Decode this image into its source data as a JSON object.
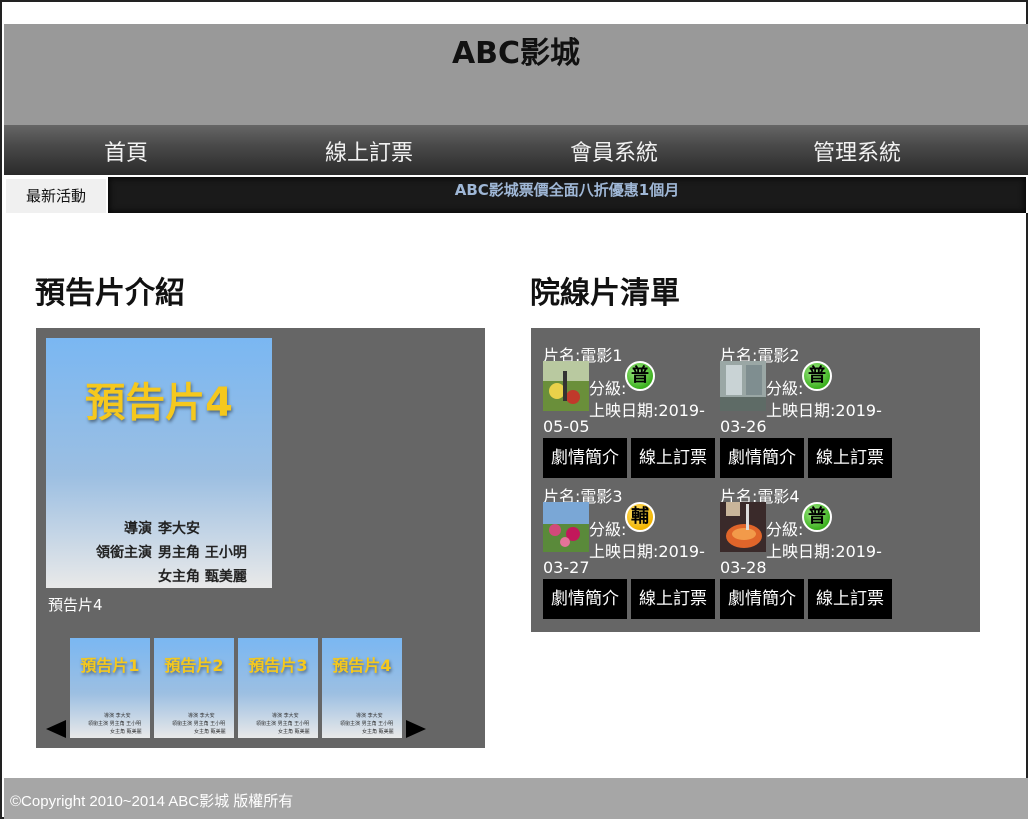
{
  "site": {
    "title": "ABC影城"
  },
  "nav": {
    "items": [
      "首頁",
      "線上訂票",
      "會員系統",
      "管理系統"
    ]
  },
  "news": {
    "label": "最新活動",
    "text": "ABC影城票價全面八折優惠1個月"
  },
  "trailers": {
    "section_title": "預告片介紹",
    "main": {
      "title": "預告片4",
      "director_label": "導演",
      "director": "李大安",
      "cast_label": "領銜主演",
      "lead_male": "男主角 王小明",
      "lead_female": "女主角 甄美麗",
      "caption": "預告片4"
    },
    "thumbnails": [
      {
        "title": "預告片1",
        "director": "導演 李大安",
        "lead_male": "領銜主演 男主角 王小明",
        "lead_female": "女主角 甄美麗"
      },
      {
        "title": "預告片2",
        "director": "導演 李大安",
        "lead_male": "領銜主演 男主角 王小明",
        "lead_female": "女主角 甄美麗"
      },
      {
        "title": "預告片3",
        "director": "導演 李大安",
        "lead_male": "領銜主演 男主角 王小明",
        "lead_female": "女主角 甄美麗"
      },
      {
        "title": "預告片4",
        "director": "導演 李大安",
        "lead_male": "領銜主演 男主角 王小明",
        "lead_female": "女主角 甄美麗"
      }
    ],
    "prev_icon": "left-triangle-icon",
    "next_icon": "right-triangle-icon"
  },
  "movies": {
    "section_title": "院線片清單",
    "items": [
      {
        "name": "片名:電影1",
        "rating_label": "分級:",
        "rating": "普",
        "rating_color": "#3cb01f",
        "date_line1": "上映日期:2019-",
        "date_line2": "05-05",
        "intro_button": "劇情簡介",
        "book_button": "線上訂票"
      },
      {
        "name": "片名:電影2",
        "rating_label": "分級:",
        "rating": "普",
        "rating_color": "#3cb01f",
        "date_line1": "上映日期:2019-",
        "date_line2": "03-26",
        "intro_button": "劇情簡介",
        "book_button": "線上訂票"
      },
      {
        "name": "片名:電影3",
        "rating_label": "分級:",
        "rating": "輔",
        "rating_color": "#f2b400",
        "date_line1": "上映日期:2019-",
        "date_line2": "03-27",
        "intro_button": "劇情簡介",
        "book_button": "線上訂票"
      },
      {
        "name": "片名:電影4",
        "rating_label": "分級:",
        "rating": "普",
        "rating_color": "#3cb01f",
        "date_line1": "上映日期:2019-",
        "date_line2": "03-28",
        "intro_button": "劇情簡介",
        "book_button": "線上訂票"
      }
    ]
  },
  "footer": {
    "text": "©Copyright 2010~2014 ABC影城 版權所有"
  },
  "colors": {
    "header_bg": "#999999",
    "panel_bg": "#666666",
    "poster_title": "#f5c81d",
    "news_text": "#9fb7d6"
  }
}
